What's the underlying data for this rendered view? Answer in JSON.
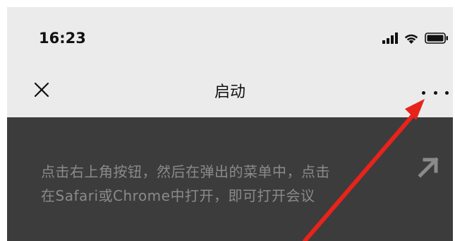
{
  "status_bar": {
    "time": "16:23",
    "signal_icon": "cellular-signal-icon",
    "wifi_icon": "wifi-icon",
    "battery_icon": "battery-icon"
  },
  "nav_bar": {
    "title": "启动",
    "close_icon": "close-icon",
    "more_icon": "more-options-icon"
  },
  "panel": {
    "hint_line1": "点击右上角按钮，然后在弹出的菜单中，点击",
    "hint_line2": "在Safari或Chrome中打开，即可打开会议",
    "arrow_icon": "arrow-up-right-icon"
  },
  "annotation": {
    "pointer_icon": "red-pointer-arrow-icon",
    "color": "#e8231a"
  },
  "colors": {
    "background": "#ebebeb",
    "panel": "#3c3c3c",
    "hint_text": "#8a8a8a"
  }
}
